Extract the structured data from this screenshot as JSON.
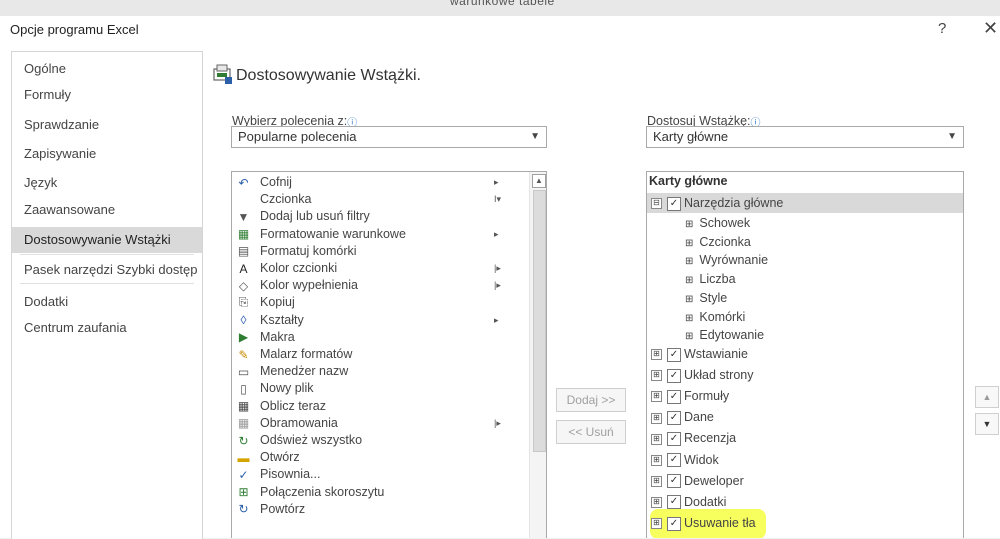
{
  "background_window": {
    "ghost_text": "warunkowe     tabele"
  },
  "dialog": {
    "title": "Opcje programu Excel",
    "help_label": "?",
    "close_label": "✕"
  },
  "sidebar": {
    "items": [
      {
        "label": "Ogólne"
      },
      {
        "label": "Formuły"
      },
      {
        "label": "Sprawdzanie"
      },
      {
        "label": "Zapisywanie"
      },
      {
        "label": "Język"
      },
      {
        "label": "Zaawansowane"
      },
      {
        "label": "Dostosowywanie Wstążki",
        "selected": true
      },
      {
        "label": "Pasek narzędzi Szybki dostęp"
      },
      {
        "label": "Dodatki"
      },
      {
        "label": "Centrum zaufania"
      }
    ]
  },
  "main": {
    "title": "Dostosowywanie Wstążki.",
    "choose_label": "Wybierz polecenia z:",
    "choose_value": "Popularne polecenia",
    "customize_label": "Dostosuj Wstążkę:",
    "customize_value": "Karty główne",
    "info_icon": "ⓘ"
  },
  "commands": [
    {
      "label": "Cofnij",
      "icon": "undo-icon",
      "glyph": "↶",
      "color": "#2b5fa8",
      "submenu": "▸"
    },
    {
      "label": "Czcionka",
      "icon": "font-icon",
      "glyph": "",
      "color": "#444",
      "submenu": "I▾"
    },
    {
      "label": "Dodaj lub usuń filtry",
      "icon": "filter-icon",
      "glyph": "▼",
      "color": "#555"
    },
    {
      "label": "Formatowanie warunkowe",
      "icon": "conditional-format-icon",
      "glyph": "▦",
      "color": "#2e7d32",
      "submenu": "▸"
    },
    {
      "label": "Formatuj komórki",
      "icon": "format-cells-icon",
      "glyph": "▤",
      "color": "#555"
    },
    {
      "label": "Kolor czcionki",
      "icon": "font-color-icon",
      "glyph": "A",
      "color": "#222",
      "submenu": "|▸"
    },
    {
      "label": "Kolor wypełnienia",
      "icon": "fill-color-icon",
      "glyph": "◇",
      "color": "#555",
      "submenu": "|▸"
    },
    {
      "label": "Kopiuj",
      "icon": "copy-icon",
      "glyph": "⎘",
      "color": "#555"
    },
    {
      "label": "Kształty",
      "icon": "shapes-icon",
      "glyph": "◊",
      "color": "#2b5fa8",
      "submenu": "▸"
    },
    {
      "label": "Makra",
      "icon": "macros-icon",
      "glyph": "▶",
      "color": "#2e7d32"
    },
    {
      "label": "Malarz formatów",
      "icon": "format-painter-icon",
      "glyph": "✎",
      "color": "#c58a00"
    },
    {
      "label": "Menedżer nazw",
      "icon": "name-manager-icon",
      "glyph": "▭",
      "color": "#555"
    },
    {
      "label": "Nowy plik",
      "icon": "new-file-icon",
      "glyph": "▯",
      "color": "#555"
    },
    {
      "label": "Oblicz teraz",
      "icon": "calculate-icon",
      "glyph": "▦",
      "color": "#444"
    },
    {
      "label": "Obramowania",
      "icon": "borders-icon",
      "glyph": "▦",
      "color": "#999",
      "submenu": "|▸"
    },
    {
      "label": "Odśwież wszystko",
      "icon": "refresh-all-icon",
      "glyph": "↻",
      "color": "#2e7d32"
    },
    {
      "label": "Otwórz",
      "icon": "open-folder-icon",
      "glyph": "▬",
      "color": "#d4a300"
    },
    {
      "label": "Pisownia...",
      "icon": "spelling-icon",
      "glyph": "✓",
      "color": "#2b5fa8"
    },
    {
      "label": "Połączenia skoroszytu",
      "icon": "workbook-connections-icon",
      "glyph": "⊞",
      "color": "#2e7d32"
    },
    {
      "label": "Powtórz",
      "icon": "redo-icon",
      "glyph": "↻",
      "color": "#2b5fa8"
    }
  ],
  "buttons": {
    "add": "Dodaj >>",
    "remove": "<< Usuń",
    "up": "▲",
    "down": "▼"
  },
  "ribbon_tree": {
    "header": "Karty główne",
    "main_tab": "Narzędzia główne",
    "groups": [
      "Schowek",
      "Czcionka",
      "Wyrównanie",
      "Liczba",
      "Style",
      "Komórki",
      "Edytowanie"
    ],
    "tabs": [
      "Wstawianie",
      "Układ strony",
      "Formuły",
      "Dane",
      "Recenzja",
      "Widok",
      "Deweloper",
      "Dodatki",
      "Usuwanie tła"
    ],
    "highlighted_tab": "Deweloper",
    "highlight_color": "#f6ff4e",
    "expand_glyph": "⊞",
    "collapse_glyph": "⊟",
    "check_glyph": "✓"
  }
}
